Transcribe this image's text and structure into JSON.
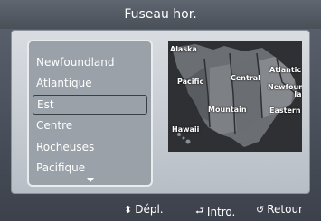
{
  "title": "Fuseau hor.",
  "timezones": [
    {
      "label": "Newfoundland",
      "selected": false
    },
    {
      "label": "Atlantique",
      "selected": false
    },
    {
      "label": "Est",
      "selected": true
    },
    {
      "label": "Centre",
      "selected": false
    },
    {
      "label": "Rocheuses",
      "selected": false
    },
    {
      "label": "Pacifique",
      "selected": false
    }
  ],
  "map": {
    "alaska": "Alaska",
    "pacific": "Pacific",
    "central": "Central",
    "atlantic": "Atlantic",
    "newfoundland": "Newfound-\nland",
    "mountain": "Mountain",
    "eastern": "Eastern",
    "hawaii": "Hawaii"
  },
  "footer": {
    "move": {
      "icon": "updown-icon",
      "glyph": "⬍",
      "label": "Dépl."
    },
    "enter": {
      "icon": "enter-icon",
      "glyph": "⮐",
      "label": "Intro."
    },
    "return": {
      "icon": "return-icon",
      "glyph": "↺",
      "label": "Retour"
    }
  }
}
